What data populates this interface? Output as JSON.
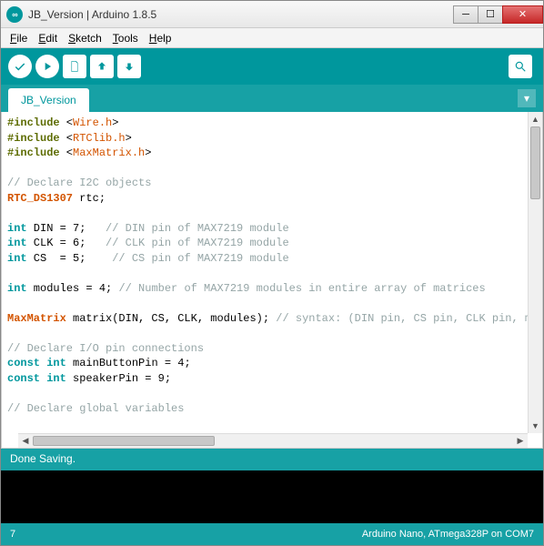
{
  "window": {
    "title": "JB_Version | Arduino 1.8.5",
    "app_icon_text": "∞"
  },
  "menubar": {
    "items": [
      {
        "label": "File",
        "u": "F"
      },
      {
        "label": "Edit",
        "u": "E"
      },
      {
        "label": "Sketch",
        "u": "S"
      },
      {
        "label": "Tools",
        "u": "T"
      },
      {
        "label": "Help",
        "u": "H"
      }
    ]
  },
  "toolbar": {
    "buttons": [
      "verify",
      "upload",
      "new",
      "open",
      "save"
    ],
    "right_button": "serial-monitor"
  },
  "tabs": {
    "active": "JB_Version",
    "dropdown_glyph": "▾"
  },
  "code": {
    "lines": [
      {
        "t": "include",
        "lib": "Wire.h"
      },
      {
        "t": "include",
        "lib": "RTClib.h"
      },
      {
        "t": "include",
        "lib": "MaxMatrix.h"
      },
      {
        "t": "blank"
      },
      {
        "t": "comment",
        "text": "// Declare I2C objects"
      },
      {
        "t": "decl_cls",
        "cls": "RTC_DS1307",
        "name": "rtc",
        "semi": ";"
      },
      {
        "t": "blank"
      },
      {
        "t": "decl_int",
        "name": "DIN",
        "val": "7",
        "pad": "   ",
        "comment": "// DIN pin of MAX7219 module"
      },
      {
        "t": "decl_int",
        "name": "CLK",
        "val": "6",
        "pad": "   ",
        "comment": "// CLK pin of MAX7219 module"
      },
      {
        "t": "decl_int",
        "name": "CS",
        "val": "5",
        "pad": "    ",
        "comment": "// CS pin of MAX7219 module",
        "sp": "  "
      },
      {
        "t": "blank"
      },
      {
        "t": "decl_int",
        "name": "modules",
        "val": "4",
        "pad": " ",
        "comment": "// Number of MAX7219 modules in entire array of matrices"
      },
      {
        "t": "blank"
      },
      {
        "t": "ctor",
        "cls": "MaxMatrix",
        "name": "matrix",
        "args": "(DIN, CS, CLK, modules);",
        "comment": " // syntax: (DIN pin, CS pin, CLK pin, mod"
      },
      {
        "t": "blank"
      },
      {
        "t": "comment",
        "text": "// Declare I/O pin connections"
      },
      {
        "t": "decl_cint",
        "name": "mainButtonPin",
        "val": "4"
      },
      {
        "t": "decl_cint",
        "name": "speakerPin",
        "val": "9"
      },
      {
        "t": "blank"
      },
      {
        "t": "comment",
        "text": "// Declare global variables"
      }
    ]
  },
  "status": {
    "message": "Done Saving."
  },
  "footer": {
    "line": "7",
    "board": "Arduino Nano, ATmega328P on COM7"
  }
}
